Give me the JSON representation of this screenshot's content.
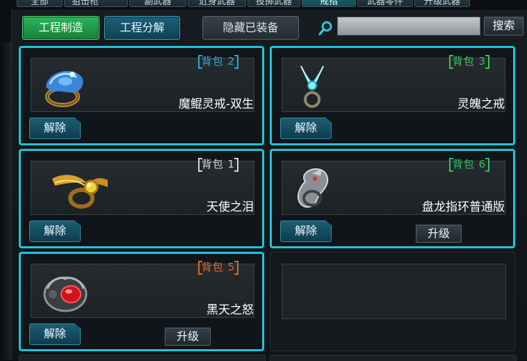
{
  "tabs": [
    {
      "label": "全部",
      "active": false
    },
    {
      "label": "狙击枪",
      "active": false
    },
    {
      "label": "副武器",
      "active": false
    },
    {
      "label": "近身武器",
      "active": false
    },
    {
      "label": "投掷武器",
      "active": false
    },
    {
      "label": "戒指",
      "active": true
    },
    {
      "label": "武器零件",
      "active": false
    },
    {
      "label": "升级武器",
      "active": false
    }
  ],
  "toolbar": {
    "make_label": "工程制造",
    "disassemble_label": "工程分解",
    "hide_equipped_label": "隐藏已装备",
    "search_value": "",
    "search_label": "搜索"
  },
  "items": [
    {
      "name": "魔鲲灵戒-双生",
      "tag": "背包 2",
      "tag_color": "#2aa9d8",
      "icon": "blue-gem-ring-icon",
      "remove_label": "解除",
      "selected": true
    },
    {
      "name": "灵魄之戒",
      "tag": "背包 3",
      "tag_color": "#3ec44f",
      "icon": "winged-cyan-ring-icon",
      "remove_label": "解除",
      "selected": true
    },
    {
      "name": "天使之泪",
      "tag": "背包 1",
      "tag_color": "#d8d8d8",
      "icon": "golden-winged-ring-icon",
      "remove_label": "解除",
      "selected": true
    },
    {
      "name": "盘龙指环普通版",
      "tag": "背包 6",
      "tag_color": "#31c06a",
      "icon": "dragon-ring-icon",
      "remove_label": "解除",
      "upgrade_label": "升级",
      "selected": true
    },
    {
      "name": "黑天之怒",
      "tag": "背包 5",
      "tag_color": "#e0672a",
      "icon": "red-gem-dark-ring-icon",
      "remove_label": "解除",
      "upgrade_label": "升级",
      "selected": true
    }
  ],
  "colors": {
    "selection": "#22c4d8",
    "make_button": "#2fb45c",
    "disassemble_button": "#1c6077"
  }
}
